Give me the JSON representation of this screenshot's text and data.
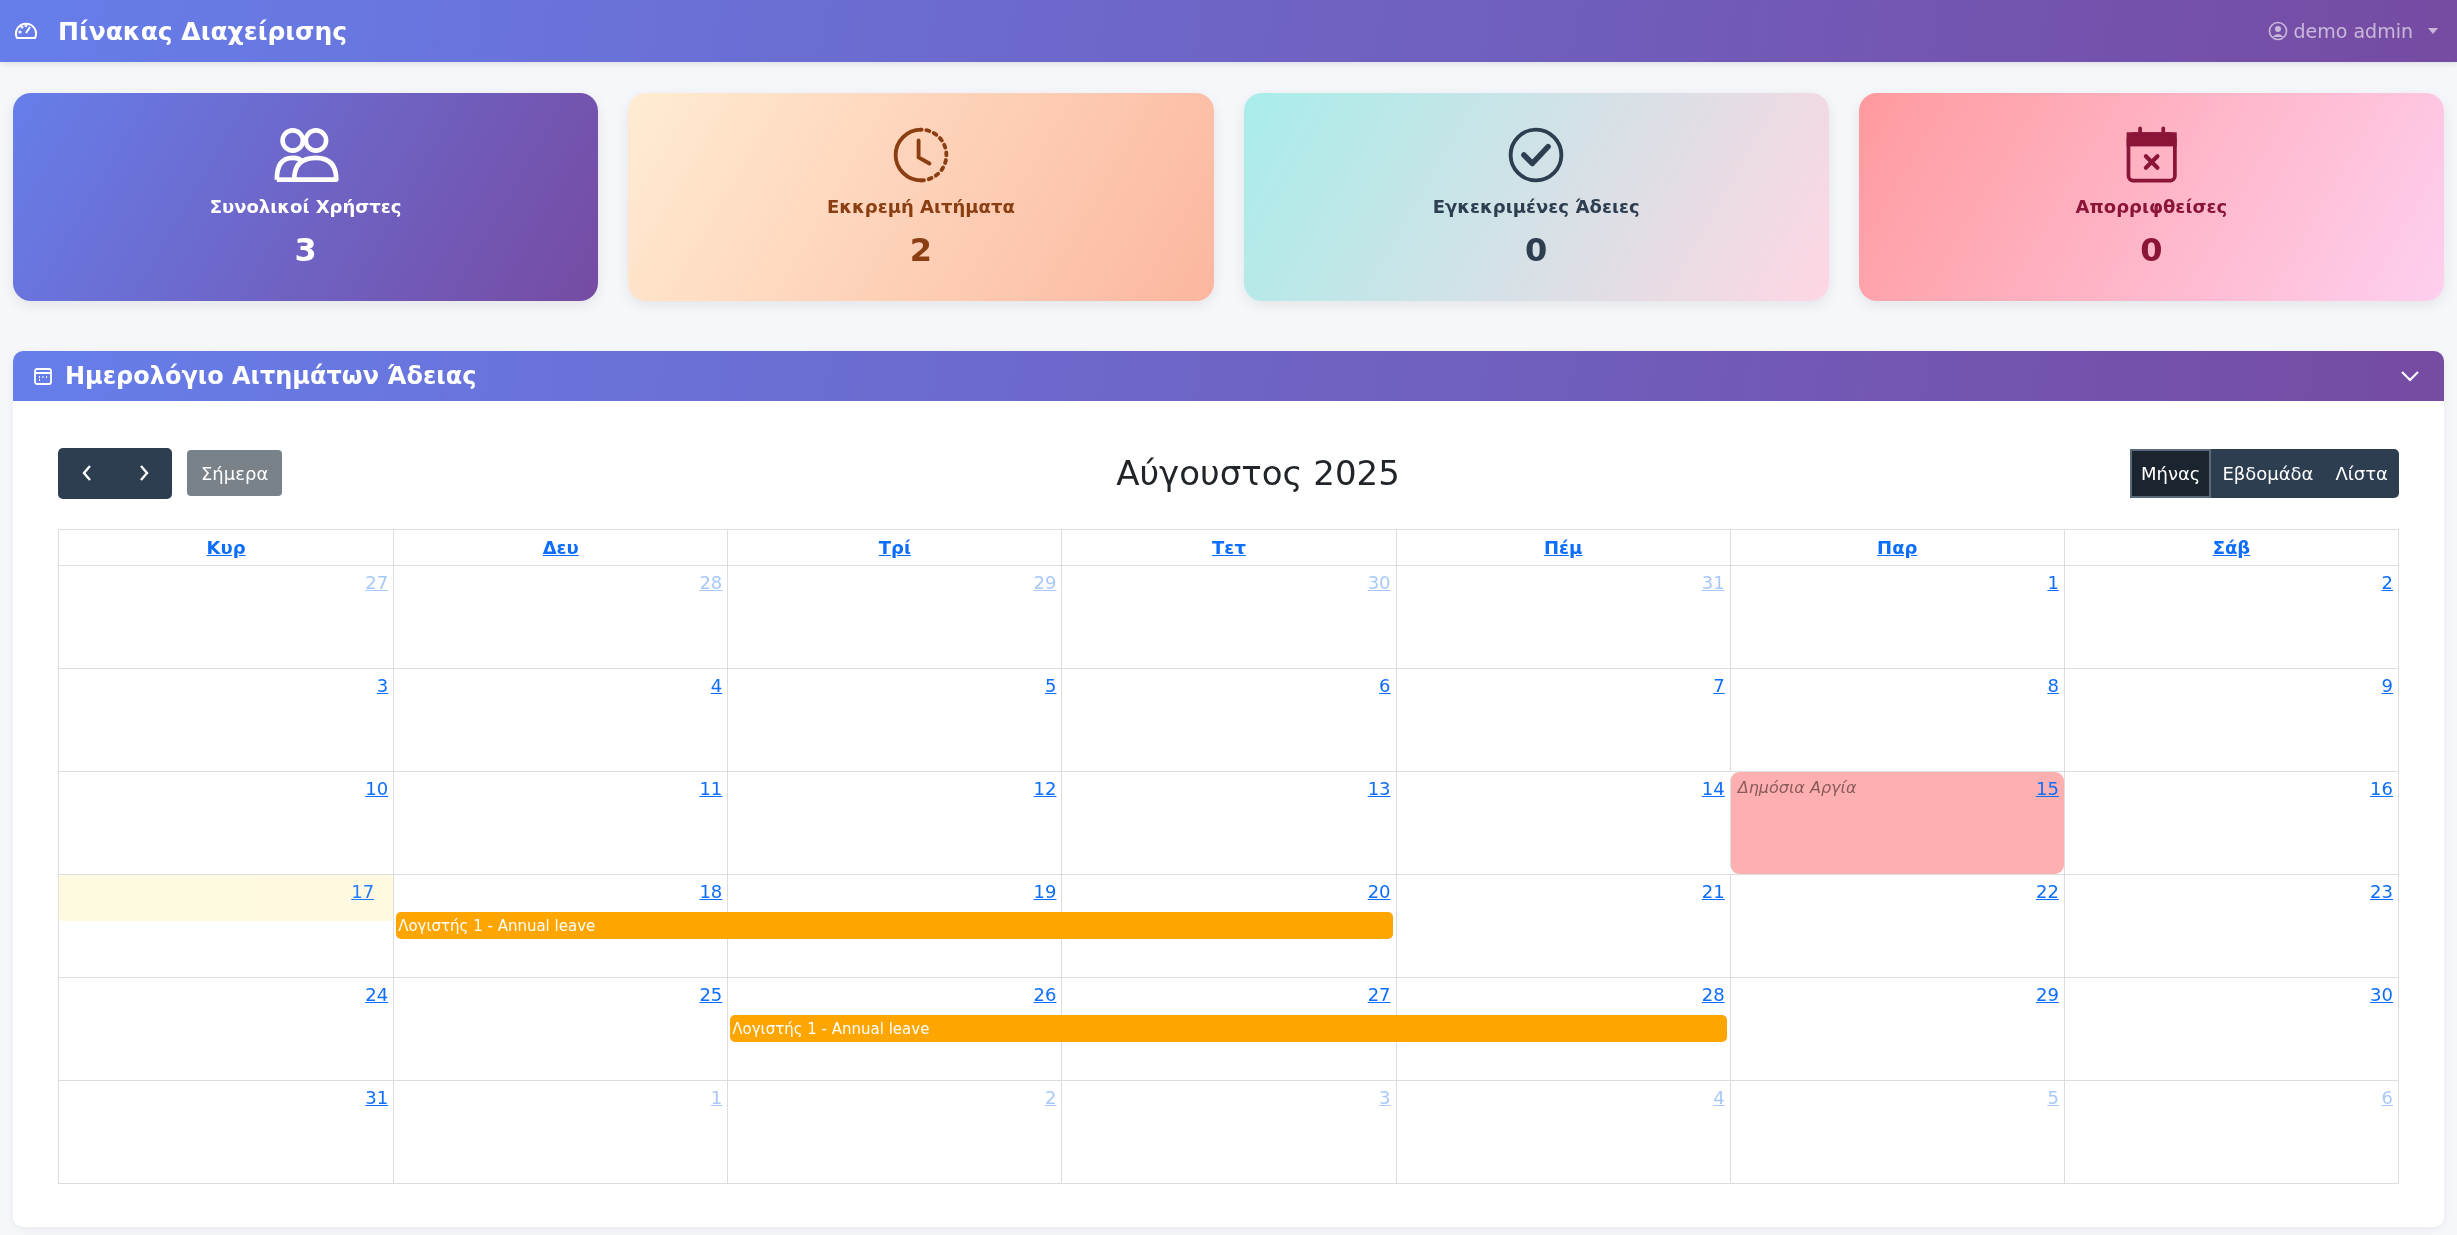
{
  "navbar": {
    "title": "Πίνακας Διαχείρισης",
    "user": "demo admin"
  },
  "stats": [
    {
      "kind": "users",
      "label": "Συνολικοί Χρήστες",
      "value": "3"
    },
    {
      "kind": "pending",
      "label": "Εκκρεμή Αιτήματα",
      "value": "2"
    },
    {
      "kind": "approved",
      "label": "Εγκεκριμένες Άδειες",
      "value": "0"
    },
    {
      "kind": "rejected",
      "label": "Απορριφθείσες",
      "value": "0"
    }
  ],
  "calendar_panel": {
    "title": "Ημερολόγιο Αιτημάτων Άδειας",
    "expanded": true
  },
  "calendar": {
    "title": "Αύγουστος 2025",
    "today_button": "Σήμερα",
    "views": [
      {
        "label": "Μήνας",
        "selected": true
      },
      {
        "label": "Εβδομάδα",
        "selected": false
      },
      {
        "label": "Λίστα",
        "selected": false
      }
    ],
    "weekdays": [
      "Κυρ",
      "Δευ",
      "Τρί",
      "Τετ",
      "Πέμ",
      "Παρ",
      "Σάβ"
    ],
    "weeks": [
      {
        "days": [
          {
            "label": "27",
            "other_month": true
          },
          {
            "label": "28",
            "other_month": true
          },
          {
            "label": "29",
            "other_month": true
          },
          {
            "label": "30",
            "other_month": true
          },
          {
            "label": "31",
            "other_month": true
          },
          {
            "label": "1",
            "other_month": false
          },
          {
            "label": "2",
            "other_month": false
          }
        ]
      },
      {
        "days": [
          {
            "label": "3",
            "other_month": false
          },
          {
            "label": "4",
            "other_month": false
          },
          {
            "label": "5",
            "other_month": false
          },
          {
            "label": "6",
            "other_month": false
          },
          {
            "label": "7",
            "other_month": false
          },
          {
            "label": "8",
            "other_month": false
          },
          {
            "label": "9",
            "other_month": false
          }
        ]
      },
      {
        "days": [
          {
            "label": "10",
            "other_month": false
          },
          {
            "label": "11",
            "other_month": false
          },
          {
            "label": "12",
            "other_month": false
          },
          {
            "label": "13",
            "other_month": false
          },
          {
            "label": "14",
            "other_month": false
          },
          {
            "label": "15",
            "other_month": false,
            "holiday": "Δημόσια Αργία"
          },
          {
            "label": "16",
            "other_month": false
          }
        ]
      },
      {
        "days": [
          {
            "label": "17",
            "other_month": false,
            "today": true
          },
          {
            "label": "18",
            "other_month": false,
            "in_event": true
          },
          {
            "label": "19",
            "other_month": false,
            "in_event": true
          },
          {
            "label": "20",
            "other_month": false,
            "in_event": true
          },
          {
            "label": "21",
            "other_month": false
          },
          {
            "label": "22",
            "other_month": false
          },
          {
            "label": "23",
            "other_month": false
          }
        ],
        "events": [
          {
            "title": "Λογιστής 1 - Annual leave",
            "color": "#ffa500"
          }
        ]
      },
      {
        "days": [
          {
            "label": "24",
            "other_month": false
          },
          {
            "label": "25",
            "other_month": false
          },
          {
            "label": "26",
            "other_month": false,
            "in_event": true
          },
          {
            "label": "27",
            "other_month": false,
            "in_event": true
          },
          {
            "label": "28",
            "other_month": false,
            "in_event": true
          },
          {
            "label": "29",
            "other_month": false
          },
          {
            "label": "30",
            "other_month": false
          }
        ],
        "events": [
          {
            "title": "Λογιστής 1 - Annual leave",
            "color": "#ffa500"
          }
        ]
      },
      {
        "days": [
          {
            "label": "31",
            "other_month": false
          },
          {
            "label": "1",
            "other_month": true
          },
          {
            "label": "2",
            "other_month": true
          },
          {
            "label": "3",
            "other_month": true
          },
          {
            "label": "4",
            "other_month": true
          },
          {
            "label": "5",
            "other_month": true
          },
          {
            "label": "6",
            "other_month": true
          }
        ]
      }
    ]
  }
}
